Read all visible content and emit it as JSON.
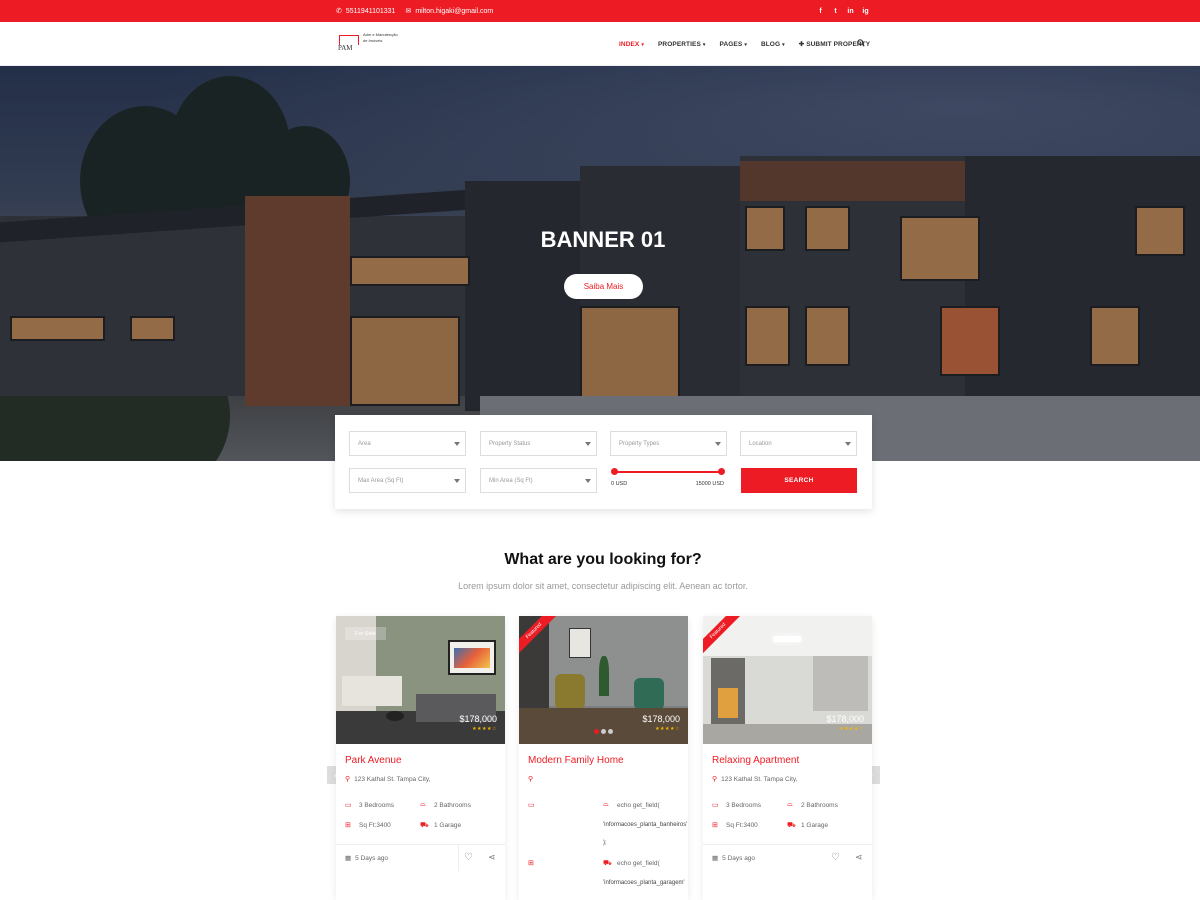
{
  "topbar": {
    "phone": "5511941101331",
    "email": "milton.higaki@gmail.com",
    "social": [
      "f",
      "t",
      "in",
      "ig"
    ]
  },
  "nav": {
    "logo_mark": "PAM",
    "logo_text": "Adm e Manutenção de Imóveis",
    "menu": [
      {
        "label": "INDEX",
        "caret": "▾"
      },
      {
        "label": "PROPERTIES",
        "caret": "▾"
      },
      {
        "label": "PAGES",
        "caret": "▾"
      },
      {
        "label": "BLOG",
        "caret": "▾"
      },
      {
        "label": "✚ SUBMIT PROPERTY",
        "caret": ""
      }
    ]
  },
  "hero": {
    "title": "BANNER 01",
    "button": "Saiba Mais"
  },
  "search": {
    "area": "Area",
    "status": "Property Status",
    "types": "Property Types",
    "location": "Location",
    "max_area": "Max Area (Sq Ft)",
    "min_area": "Min Area (Sq Ft)",
    "price_min": "0 USD",
    "price_max": "15000 USD",
    "button": "SEARCH"
  },
  "section": {
    "title": "What are you looking for?",
    "subtitle": "Lorem ipsum dolor sit amet, consectetur adipiscing elit. Aenean ac tortor."
  },
  "cards": [
    {
      "badge": "For Sale",
      "price": "$178,000",
      "stars": "★★★★☆",
      "title": "Park Avenue",
      "address": "123 Kathal St. Tampa City,",
      "bedrooms": "3 Bedrooms",
      "bathrooms": "2 Bathrooms",
      "sqft": "Sq Ft:3400",
      "garage": "1 Garage",
      "date": "5 Days ago"
    },
    {
      "ribbon": "Featured",
      "price": "$178,000",
      "stars": "★★★★☆",
      "title": "Modern Family Home",
      "field1": "echo get_field(",
      "field1b": "'informacoes_planta_banheiros'",
      "field1c": ");",
      "field2": "echo get_field(",
      "field2b": "'informacoes_planta_garagem'"
    },
    {
      "ribbon": "Featured",
      "price": "$178,000",
      "stars": "★★★★☆",
      "title": "Relaxing Apartment",
      "address": "123 Kathal St. Tampa City,",
      "bedrooms": "3 Bedrooms",
      "bathrooms": "2 Bathrooms",
      "sqft": "Sq Ft:3400",
      "garage": "1 Garage",
      "date": "5 Days ago"
    }
  ],
  "carousel": {
    "prev": "‹",
    "next": "›"
  },
  "colors": {
    "accent": "#ed1c24"
  }
}
